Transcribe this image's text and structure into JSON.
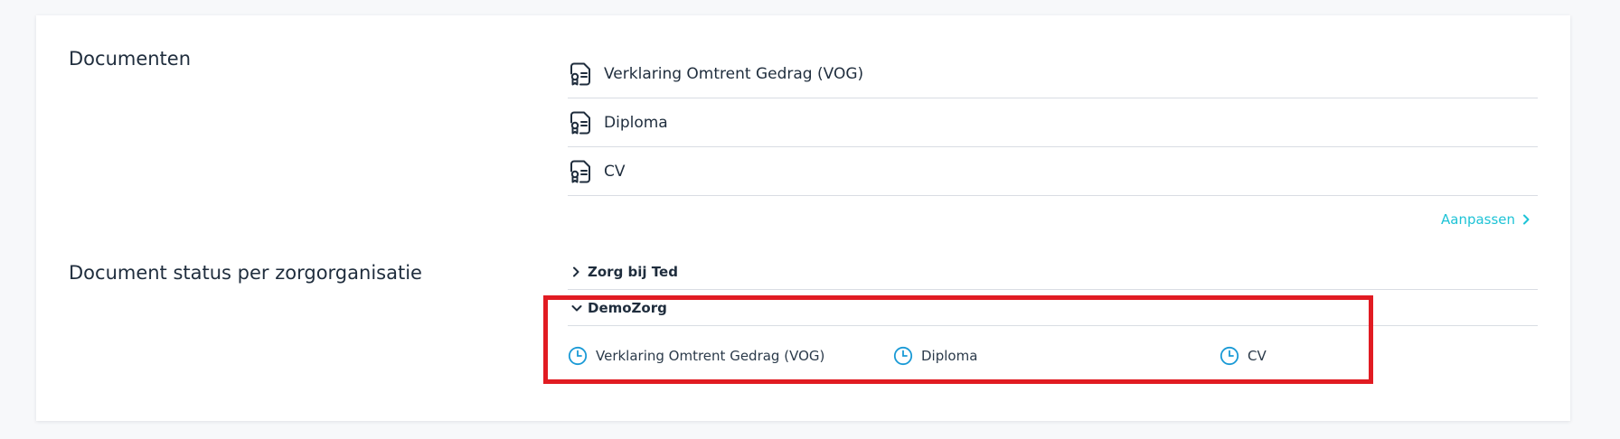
{
  "documents": {
    "title": "Documenten",
    "items": [
      {
        "label": "Verklaring Omtrent Gedrag (VOG)",
        "icon": "document-icon"
      },
      {
        "label": "Diploma",
        "icon": "document-icon"
      },
      {
        "label": "CV",
        "icon": "document-icon"
      }
    ],
    "edit_label": "Aanpassen"
  },
  "status": {
    "title": "Document status per zorgorganisatie",
    "organisations": [
      {
        "name": "Zorg bij Ted",
        "expanded": false
      },
      {
        "name": "DemoZorg",
        "expanded": true
      }
    ],
    "demozorg_documents": [
      {
        "label": "Verklaring Omtrent Gedrag (VOG)",
        "status_icon": "clock-icon"
      },
      {
        "label": "Diploma",
        "status_icon": "clock-icon"
      },
      {
        "label": "CV",
        "status_icon": "clock-icon"
      }
    ]
  },
  "colors": {
    "accent": "#1ec3d6",
    "clock": "#1a9ad6",
    "highlight": "#e11b22",
    "text": "#1f2d3d",
    "divider": "#d9dde3"
  }
}
